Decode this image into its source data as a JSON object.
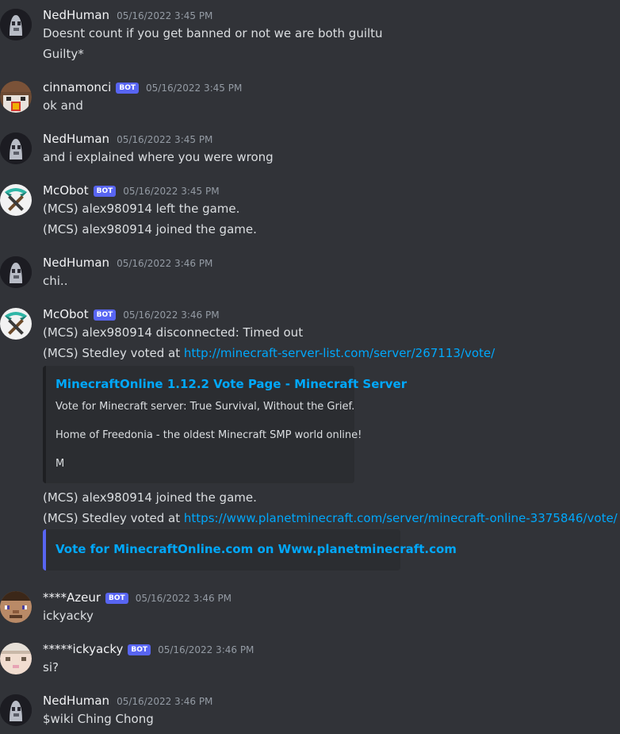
{
  "messages": [
    {
      "user": "NedHuman",
      "bot": false,
      "time": "05/16/2022 3:45 PM",
      "lines": [
        "Doesnt count if you get banned or not we are both guiltu",
        "Guilty*"
      ]
    },
    {
      "user": "cinnamonci",
      "bot": true,
      "time": "05/16/2022 3:45 PM",
      "lines": [
        "ok and"
      ]
    },
    {
      "user": "NedHuman",
      "bot": false,
      "time": "05/16/2022 3:45 PM",
      "lines": [
        "and i explained where you were wrong"
      ]
    },
    {
      "user": "McObot",
      "bot": true,
      "time": "05/16/2022 3:45 PM",
      "lines": [
        "(MCS) alex980914 left the game.",
        "(MCS) alex980914 joined the game."
      ]
    },
    {
      "user": "NedHuman",
      "bot": false,
      "time": "05/16/2022 3:46 PM",
      "lines": [
        "chi.."
      ]
    },
    {
      "user": "McObot",
      "bot": true,
      "time": "05/16/2022 3:46 PM",
      "lines": [
        "(MCS) alex980914 disconnected: Timed out"
      ],
      "vote1_prefix": "(MCS) Stedley voted at ",
      "vote1_link": "http://minecraft-server-list.com/server/267113/vote/",
      "embed1": {
        "title": "MinecraftOnline 1.12.2 Vote Page - Minecraft Server",
        "desc1": "Vote for Minecraft server: True Survival, Without the Grief.",
        "desc2": "Home of Freedonia - the oldest Minecraft SMP world online!",
        "desc3": "M"
      },
      "line_after": "(MCS) alex980914 joined the game.",
      "vote2_prefix": "(MCS) Stedley voted at ",
      "vote2_link": "https://www.planetminecraft.com/server/minecraft-online-3375846/vote/",
      "embed2": {
        "title": "Vote for MinecraftOnline.com on Www.planetminecraft.com"
      }
    },
    {
      "user": "****Azeur",
      "bot": true,
      "time": "05/16/2022 3:46 PM",
      "lines": [
        "ickyacky"
      ]
    },
    {
      "user": "*****ickyacky",
      "bot": true,
      "time": "05/16/2022 3:46 PM",
      "lines": [
        "si?"
      ]
    },
    {
      "user": "NedHuman",
      "bot": false,
      "time": "05/16/2022 3:46 PM",
      "lines": [
        "$wiki Ching Chong"
      ]
    }
  ],
  "bot_label": "BOT",
  "colors": {
    "background": "#313338",
    "link": "#00a8fc",
    "bot_tag": "#5865f2",
    "embed_bg": "#2b2d31",
    "embed2_border": "#5865f2"
  },
  "avatars": [
    "ghost-skin-icon",
    "blocky-face-icon",
    "ghost-skin-icon",
    "diamond-pickaxe-icon",
    "ghost-skin-icon",
    "diamond-pickaxe-icon",
    "steve-face-icon",
    "pale-face-icon",
    "ghost-skin-icon"
  ]
}
